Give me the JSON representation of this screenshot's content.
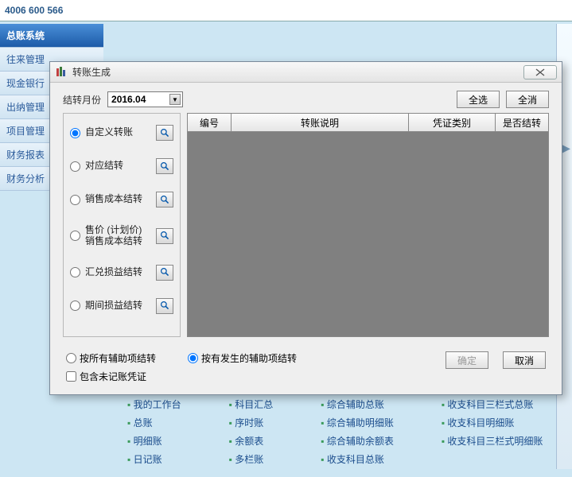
{
  "phone": "4006 600 566",
  "sidebar": {
    "items": [
      {
        "label": "总账系统",
        "active": true
      },
      {
        "label": "往来管理"
      },
      {
        "label": "现金银行"
      },
      {
        "label": "出纳管理"
      },
      {
        "label": "项目管理"
      },
      {
        "label": "财务报表"
      },
      {
        "label": "财务分析"
      }
    ]
  },
  "dialog": {
    "title": "转账生成",
    "month_label": "结转月份",
    "month_value": "2016.04",
    "select_all": "全选",
    "deselect_all": "全消",
    "columns": [
      "编号",
      "转账说明",
      "凭证类别",
      "是否结转"
    ],
    "options": [
      "自定义转账",
      "对应结转",
      "销售成本结转",
      "售价 (计划价)\n销售成本结转",
      "汇兑损益结转",
      "期间损益结转"
    ],
    "bottom_opt1": "按所有辅助项结转",
    "bottom_opt2": "按有发生的辅助项结转",
    "bottom_chk": "包含未记账凭证",
    "ok": "确定",
    "cancel": "取消"
  },
  "bg_links": {
    "col1": [
      "我的工作台",
      "总账",
      "明细账",
      "日记账"
    ],
    "col2": [
      "科目汇总",
      "序时账",
      "余额表",
      "多栏账"
    ],
    "col3": [
      "综合辅助总账",
      "综合辅助明细账",
      "综合辅助余额表",
      "收支科目总账"
    ],
    "col4": [
      "收支科目三栏式总账",
      "收支科目明细账",
      "收支科目三栏式明细账"
    ]
  }
}
